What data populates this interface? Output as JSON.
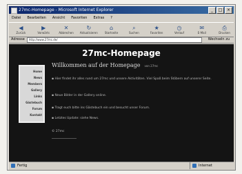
{
  "window": {
    "title": "27mc-Homepage - Microsoft Internet Explorer"
  },
  "menu": [
    "Datei",
    "Bearbeiten",
    "Ansicht",
    "Favoriten",
    "Extras",
    "?"
  ],
  "toolbar": [
    {
      "label": "Zurück",
      "icon": "back-icon"
    },
    {
      "label": "Vorwärts",
      "icon": "forward-icon"
    },
    {
      "label": "Abbrechen",
      "icon": "stop-icon"
    },
    {
      "label": "Aktualisieren",
      "icon": "refresh-icon"
    },
    {
      "label": "Startseite",
      "icon": "home-icon"
    },
    {
      "label": "Suchen",
      "icon": "search-icon"
    },
    {
      "label": "Favoriten",
      "icon": "favorites-icon"
    },
    {
      "label": "Verlauf",
      "icon": "history-icon"
    },
    {
      "label": "E-Mail",
      "icon": "mail-icon"
    },
    {
      "label": "Drucken",
      "icon": "print-icon"
    }
  ],
  "address": {
    "label": "Adresse",
    "value": "http://www.27mc.de/",
    "go": "Wechseln zu"
  },
  "page": {
    "title": "27mc-Homepage",
    "greeting": "Willkommen auf der Homepage",
    "greeting_small": "von 27mc",
    "sidebar_items": [
      "Home",
      "News",
      "Members",
      "Gallery",
      "Links",
      "Gästebuch",
      "Forum",
      "Kontakt"
    ],
    "p1": "▪ Hier findet ihr alles rund um 27mc und unsere Aktivitäten. Viel Spaß beim Stöbern auf unserer Seite.",
    "p2": "▪ Neue Bilder in der Gallery online.",
    "p3": "▪ Tragt euch bitte ins Gästebuch ein und besucht unser Forum.",
    "p4": "▪ Letztes Update: siehe News.",
    "p5": "© 27mc"
  },
  "status": {
    "left": "Fertig",
    "right": "Internet"
  }
}
